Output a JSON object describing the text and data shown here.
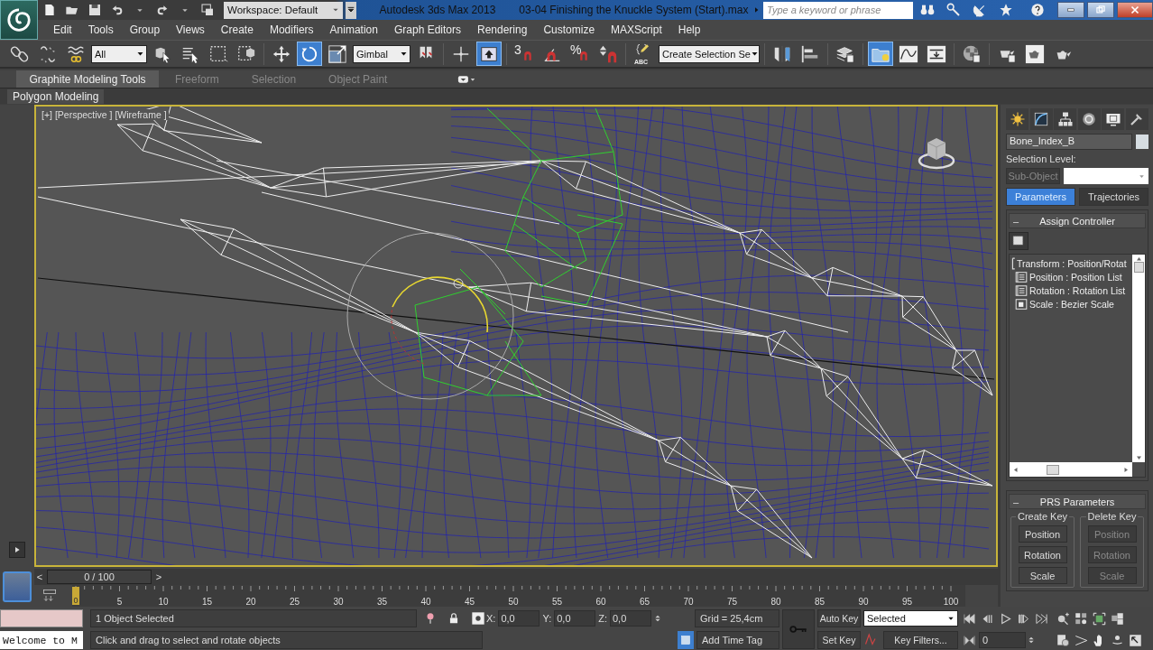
{
  "title_bar": {
    "workspace": "Workspace: Default",
    "app_title": "Autodesk 3ds Max  2013",
    "file_title": "03-04 Finishing the Knuckle System (Start).max",
    "search_placeholder": "Type a keyword or phrase"
  },
  "menu": [
    "Edit",
    "Tools",
    "Group",
    "Views",
    "Create",
    "Modifiers",
    "Animation",
    "Graph Editors",
    "Rendering",
    "Customize",
    "MAXScript",
    "Help"
  ],
  "toolbar": [
    {
      "kind": "button",
      "selected": false
    },
    {
      "kind": "button",
      "selected": false
    },
    {
      "kind": "button",
      "selected": false
    },
    {
      "kind": "dropdown",
      "value": "All"
    },
    {
      "kind": "button",
      "selected": false
    },
    {
      "kind": "button",
      "selected": false
    },
    {
      "kind": "button",
      "selected": false
    },
    {
      "kind": "button",
      "selected": false
    },
    {
      "kind": "separator"
    },
    {
      "kind": "button",
      "selected": false
    },
    {
      "kind": "button",
      "selected": true
    },
    {
      "kind": "button",
      "selected": false
    },
    {
      "kind": "dropdown",
      "value": "Gimbal"
    },
    {
      "kind": "button",
      "selected": false
    },
    {
      "kind": "separator"
    },
    {
      "kind": "button",
      "selected": false
    },
    {
      "kind": "button",
      "selected": true
    },
    {
      "kind": "separator"
    },
    {
      "kind": "labeled",
      "label": "3",
      "selected": false
    },
    {
      "kind": "button",
      "selected": false
    },
    {
      "kind": "labeled",
      "label": "%",
      "selected": false
    },
    {
      "kind": "button",
      "selected": false
    },
    {
      "kind": "separator"
    },
    {
      "kind": "labeled",
      "label": "ABC",
      "selected": false
    },
    {
      "kind": "dropdown",
      "value": "Create Selection Se"
    },
    {
      "kind": "separator"
    },
    {
      "kind": "button",
      "selected": false
    },
    {
      "kind": "button",
      "selected": false
    },
    {
      "kind": "separator"
    },
    {
      "kind": "button",
      "selected": false
    },
    {
      "kind": "separator"
    },
    {
      "kind": "button",
      "selected": true
    },
    {
      "kind": "button",
      "selected": false
    },
    {
      "kind": "button",
      "selected": false
    },
    {
      "kind": "separator"
    },
    {
      "kind": "button",
      "selected": false
    },
    {
      "kind": "separator"
    },
    {
      "kind": "button",
      "selected": false
    },
    {
      "kind": "button",
      "selected": false
    },
    {
      "kind": "button",
      "selected": false
    }
  ],
  "ribbon": {
    "tabs": [
      {
        "label": "Graphite Modeling Tools",
        "selected": true
      },
      {
        "label": "Freeform",
        "selected": false
      },
      {
        "label": "Selection",
        "selected": false
      },
      {
        "label": "Object Paint",
        "selected": false
      }
    ],
    "panel": "Polygon Modeling"
  },
  "viewport": {
    "label": "[+] [Perspective ] [Wireframe ]",
    "active": true
  },
  "command_panel": {
    "object_name": "Bone_Index_B",
    "selection_level_label": "Selection Level:",
    "sub_object": {
      "label": "Sub-Object",
      "disabled": true
    },
    "tabs": [
      {
        "label": "Parameters",
        "selected": true
      },
      {
        "label": "Trajectories",
        "selected": false
      }
    ],
    "assign_controller": {
      "title": "Assign Controller",
      "collapse": "–",
      "tree": [
        {
          "label": "Transform : Position/Rotat",
          "children": [
            {
              "label": "Position : Position List"
            },
            {
              "label": "Rotation : Rotation List"
            },
            {
              "label": "Scale : Bezier Scale"
            }
          ]
        }
      ]
    },
    "prs": {
      "title": "PRS Parameters",
      "collapse": "–",
      "groups": [
        {
          "title": "Create Key",
          "buttons": [
            {
              "label": "Position",
              "disabled": false
            },
            {
              "label": "Rotation",
              "disabled": false
            },
            {
              "label": "Scale",
              "disabled": false
            }
          ]
        },
        {
          "title": "Delete Key",
          "buttons": [
            {
              "label": "Position",
              "disabled": true
            },
            {
              "label": "Rotation",
              "disabled": true
            },
            {
              "label": "Scale",
              "disabled": true
            }
          ]
        }
      ]
    }
  },
  "time_slider": {
    "prev": "<",
    "next": ">",
    "readout": "0 / 100"
  },
  "track": {
    "marker": "0",
    "labels": [
      "5",
      "10",
      "15",
      "20",
      "25",
      "30",
      "35",
      "40",
      "45",
      "50",
      "55",
      "60",
      "65",
      "70",
      "75",
      "80",
      "85",
      "90",
      "95",
      "100"
    ]
  },
  "status": {
    "listener": "Welcome to M",
    "selection": "1 Object Selected",
    "prompt": "Click and drag to select and rotate objects",
    "x": "X:",
    "x_value": "0,0",
    "y": "Y:",
    "y_value": "0,0",
    "z": "Z:",
    "z_value": "0,0",
    "grid": "Grid = 25,4cm",
    "time_tag": "Add Time Tag",
    "auto_key": "Auto Key",
    "set_key": "Set Key",
    "key_mode": "Selected",
    "key_filters": "Key Filters...",
    "frame": "0"
  }
}
